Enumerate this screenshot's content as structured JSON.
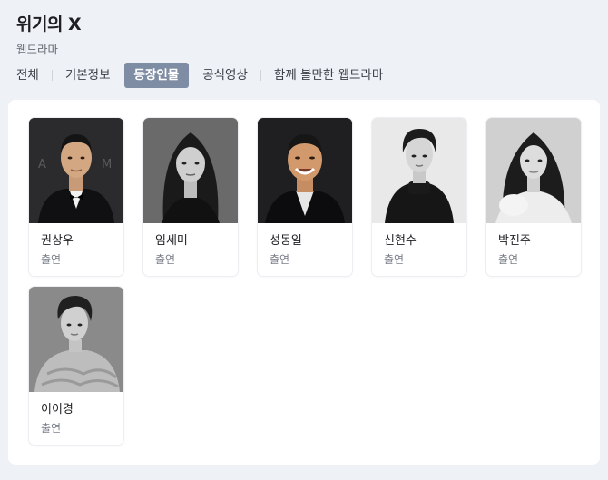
{
  "header": {
    "title": "위기의 X",
    "subtitle": "웹드라마"
  },
  "tabs": [
    {
      "label": "전체",
      "active": false
    },
    {
      "label": "기본정보",
      "active": false
    },
    {
      "label": "등장인물",
      "active": true
    },
    {
      "label": "공식영상",
      "active": false
    },
    {
      "label": "함께 볼만한 웹드라마",
      "active": false
    }
  ],
  "cast": [
    {
      "name": "권상우",
      "role": "출연"
    },
    {
      "name": "임세미",
      "role": "출연"
    },
    {
      "name": "성동일",
      "role": "출연"
    },
    {
      "name": "신현수",
      "role": "출연"
    },
    {
      "name": "박진주",
      "role": "출연"
    },
    {
      "name": "이이경",
      "role": "출연"
    }
  ],
  "colors": {
    "accent_tab": "#7f8da4",
    "page_bg": "#eef1f6"
  }
}
